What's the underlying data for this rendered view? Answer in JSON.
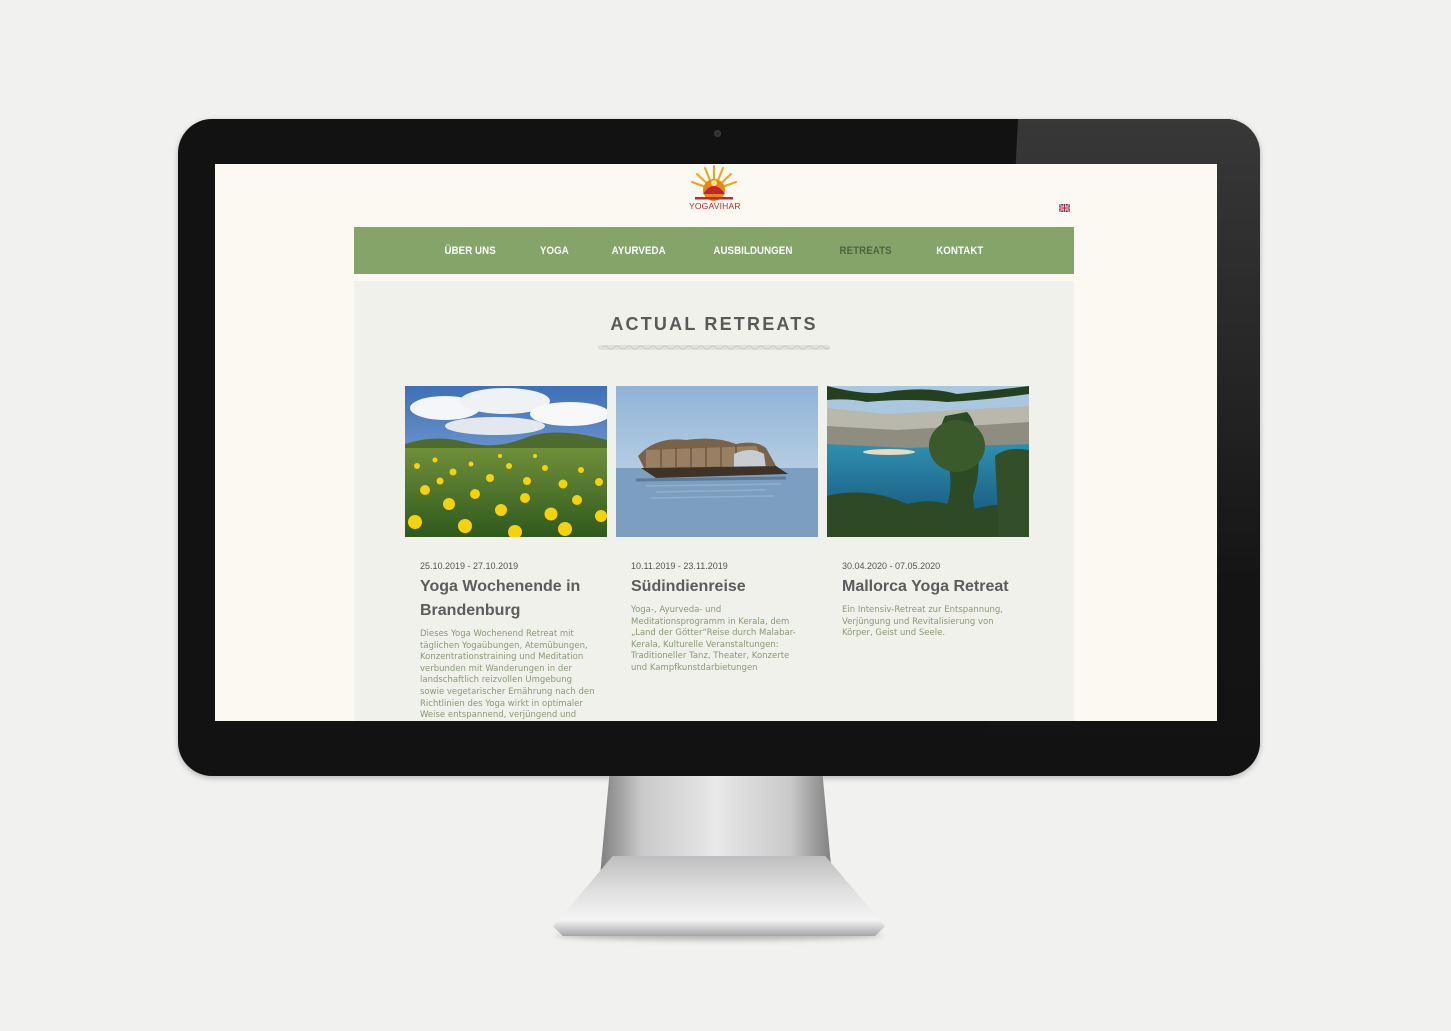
{
  "site": {
    "logo_text": "YOGAVIHAR",
    "language_flag": "uk-flag-icon"
  },
  "nav": {
    "items": [
      {
        "label": "ÜBER UNS"
      },
      {
        "label": "YOGA"
      },
      {
        "label": "AYURVEDA"
      },
      {
        "label": "AUSBILDUNGEN"
      },
      {
        "label": "RETREATS",
        "active": true
      },
      {
        "label": "KONTAKT"
      }
    ]
  },
  "section": {
    "title": "ACTUAL RETREATS"
  },
  "retreats": [
    {
      "date": "25.10.2019 - 27.10.2019",
      "title": "Yoga Wochenende in Brandenburg",
      "description": "Dieses Yoga Wochenend Retreat mit täglichen Yogaübungen, Atemübungen, Konzentrationstraining und Meditation verbunden mit Wanderungen in der landschaftlich reizvollen Umgebung sowie vegetarischer Ernährung nach den Richtlinien des Yoga wirkt in optimaler Weise entspannend, verjüngend und",
      "image": "dandelion-meadow-image"
    },
    {
      "date": "10.11.2019 - 23.11.2019",
      "title": "Südindienreise",
      "description": "Yoga-, Ayurveda- und Meditationsprogramm in Kerala, dem „Land der Götter“Reise durch Malabar-Kerala, Kulturelle Veranstaltungen: Traditioneller Tanz, Theater, Konzerte und Kampfkunstdarbietungen",
      "image": "houseboat-image"
    },
    {
      "date": "30.04.2020 - 07.05.2020",
      "title": "Mallorca Yoga Retreat",
      "description": "Ein Intensiv-Retreat zur Entspannung, Verjüngung und Revitalisierung von Körper, Geist und Seele.",
      "image": "mallorca-bay-image"
    }
  ],
  "colors": {
    "nav_bg": "#84a46a",
    "nav_active": "#4d6440",
    "content_bg": "#eff1ea",
    "page_bg": "#fbf9f1",
    "logo_red": "#c0272d"
  }
}
